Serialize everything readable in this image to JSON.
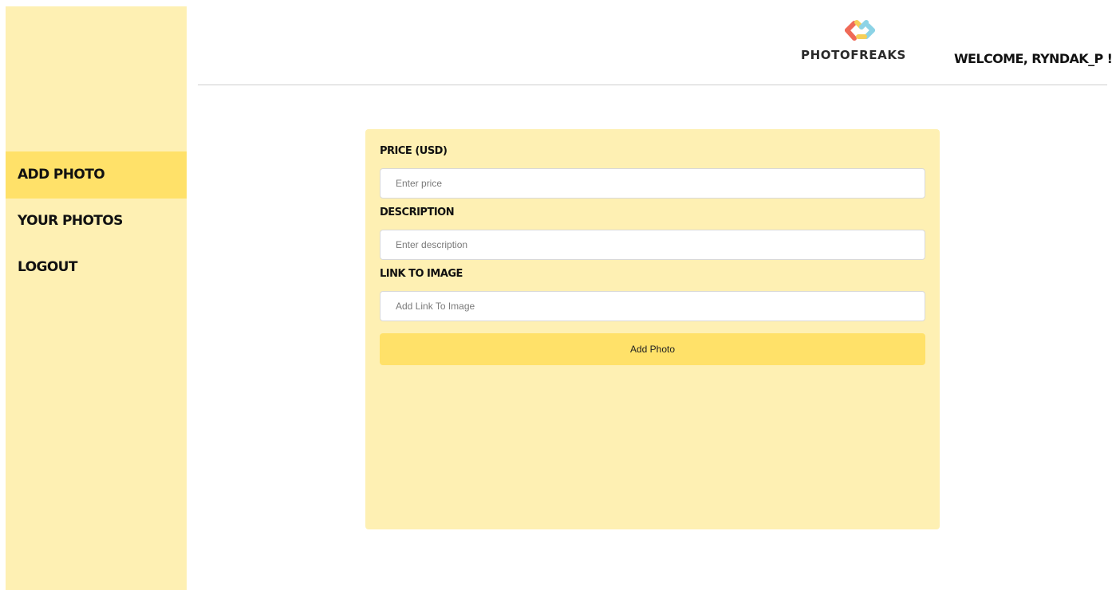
{
  "brand": {
    "name": "PHOTOFREAKS",
    "logo_icon": "photofreaks-dots-logo",
    "logo_colors": [
      "#ef6a57",
      "#f6cf58",
      "#8cd3e6"
    ]
  },
  "header": {
    "welcome": "WELCOME, RYNDAK_P !"
  },
  "sidebar": {
    "items": [
      {
        "label": "ADD PHOTO",
        "active": true
      },
      {
        "label": "YOUR PHOTOS",
        "active": false
      },
      {
        "label": "LOGOUT",
        "active": false
      }
    ]
  },
  "form": {
    "price": {
      "label": "PRICE (USD)",
      "placeholder": "Enter price",
      "value": ""
    },
    "description": {
      "label": "DESCRIPTION",
      "placeholder": "Enter description",
      "value": ""
    },
    "link": {
      "label": "LINK TO IMAGE",
      "placeholder": "Add Link To Image",
      "value": ""
    },
    "submit_label": "Add Photo"
  },
  "colors": {
    "sidebar_bg": "#fef0b3",
    "accent": "#ffe169",
    "card_bg": "#fef0b3"
  }
}
